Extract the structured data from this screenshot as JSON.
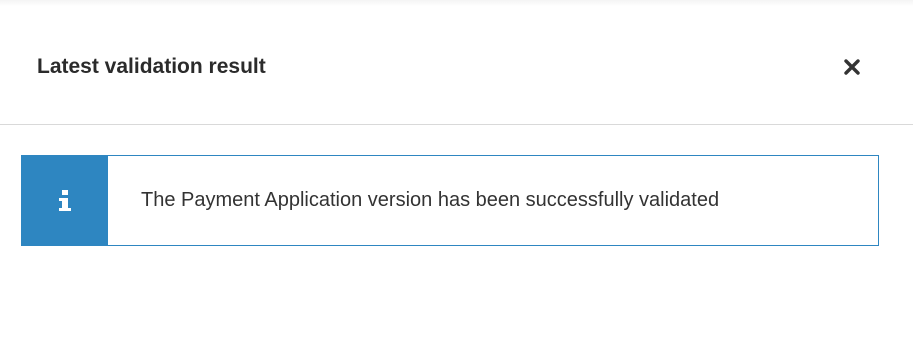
{
  "dialog": {
    "title": "Latest validation result",
    "close_icon": "close-icon"
  },
  "alert": {
    "icon": "info-icon",
    "message": "The Payment Application version has been successfully validated",
    "accent_color": "#2e86c1"
  }
}
